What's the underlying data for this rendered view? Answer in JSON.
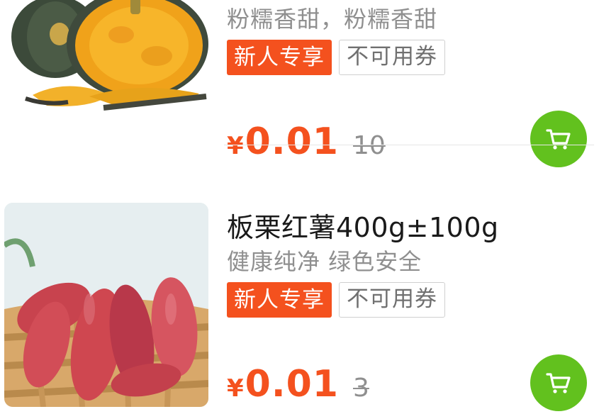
{
  "products": [
    {
      "title": "",
      "subtitle": "粉糯香甜，粉糯香甜",
      "tag_new": "新人专享",
      "tag_coupon": "不可用券",
      "currency": "¥",
      "price": "0.01",
      "original_price": "10",
      "image_icon": "pumpkin-image",
      "cart_icon": "cart-icon"
    },
    {
      "title": "板栗红薯400g±100g",
      "subtitle": "健康纯净 绿色安全",
      "tag_new": "新人专享",
      "tag_coupon": "不可用券",
      "currency": "¥",
      "price": "0.01",
      "original_price": "3",
      "image_icon": "sweet-potato-image",
      "cart_icon": "cart-icon"
    }
  ],
  "colors": {
    "accent": "#f4511e",
    "cart": "#62c11e",
    "muted": "#8f8f8f"
  }
}
